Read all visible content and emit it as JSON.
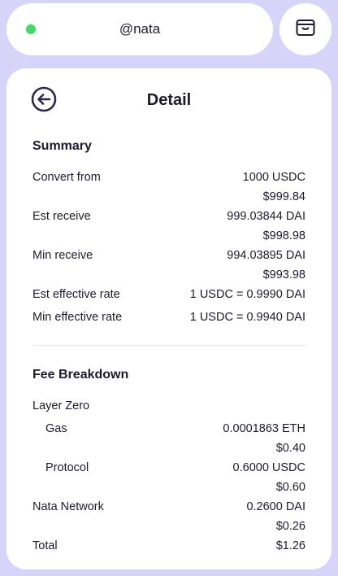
{
  "header": {
    "account_name": "@nata",
    "status_color": "#3ddc63",
    "wallet_icon": "wallet-icon"
  },
  "detail": {
    "title": "Detail",
    "back_icon": "arrow-left-circle-icon",
    "summary": {
      "title": "Summary",
      "convert_from": {
        "label": "Convert from",
        "amount": "1000 USDC",
        "usd": "$999.84"
      },
      "est_receive": {
        "label": "Est receive",
        "amount": "999.03844 DAI",
        "usd": "$998.98"
      },
      "min_receive": {
        "label": "Min receive",
        "amount": "994.03895 DAI",
        "usd": "$993.98"
      },
      "est_rate": {
        "label": "Est effective rate",
        "value": "1 USDC = 0.9990 DAI"
      },
      "min_rate": {
        "label": "Min effective rate",
        "value": "1 USDC = 0.9940 DAI"
      }
    },
    "fees": {
      "title": "Fee Breakdown",
      "layer_zero": {
        "label": "Layer Zero"
      },
      "gas": {
        "label": "Gas",
        "amount": "0.0001863 ETH",
        "usd": "$0.40"
      },
      "protocol": {
        "label": "Protocol",
        "amount": "0.6000 USDC",
        "usd": "$0.60"
      },
      "nata_network": {
        "label": "Nata Network",
        "amount": "0.2600 DAI",
        "usd": "$0.26"
      },
      "total": {
        "label": "Total",
        "value": "$1.26"
      }
    }
  }
}
